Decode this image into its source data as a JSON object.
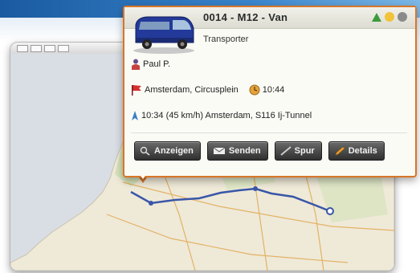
{
  "popup": {
    "title": "0014 - M12 - Van",
    "subtitle": "Transporter",
    "driver": "Paul P.",
    "destination": "Amsterdam, Circusplein",
    "eta": "10:44",
    "last_position": "10:34 (45 km/h)  Amsterdam, S116 Ij-Tunnel",
    "status_colors": {
      "warning": "#3c9a3c",
      "sun": "#f2c23a",
      "neutral": "#8a8a8a"
    },
    "buttons": [
      {
        "label": "Anzeigen",
        "icon": "zoom-icon"
      },
      {
        "label": "Senden",
        "icon": "send-icon"
      },
      {
        "label": "Spur",
        "icon": "track-icon"
      },
      {
        "label": "Details",
        "icon": "pencil-icon"
      }
    ]
  },
  "colors": {
    "accent": "#d87628",
    "banner": "#1a5aa0",
    "route": "#3957a8",
    "sea": "#d9dee4",
    "land": "#f0eadb"
  }
}
